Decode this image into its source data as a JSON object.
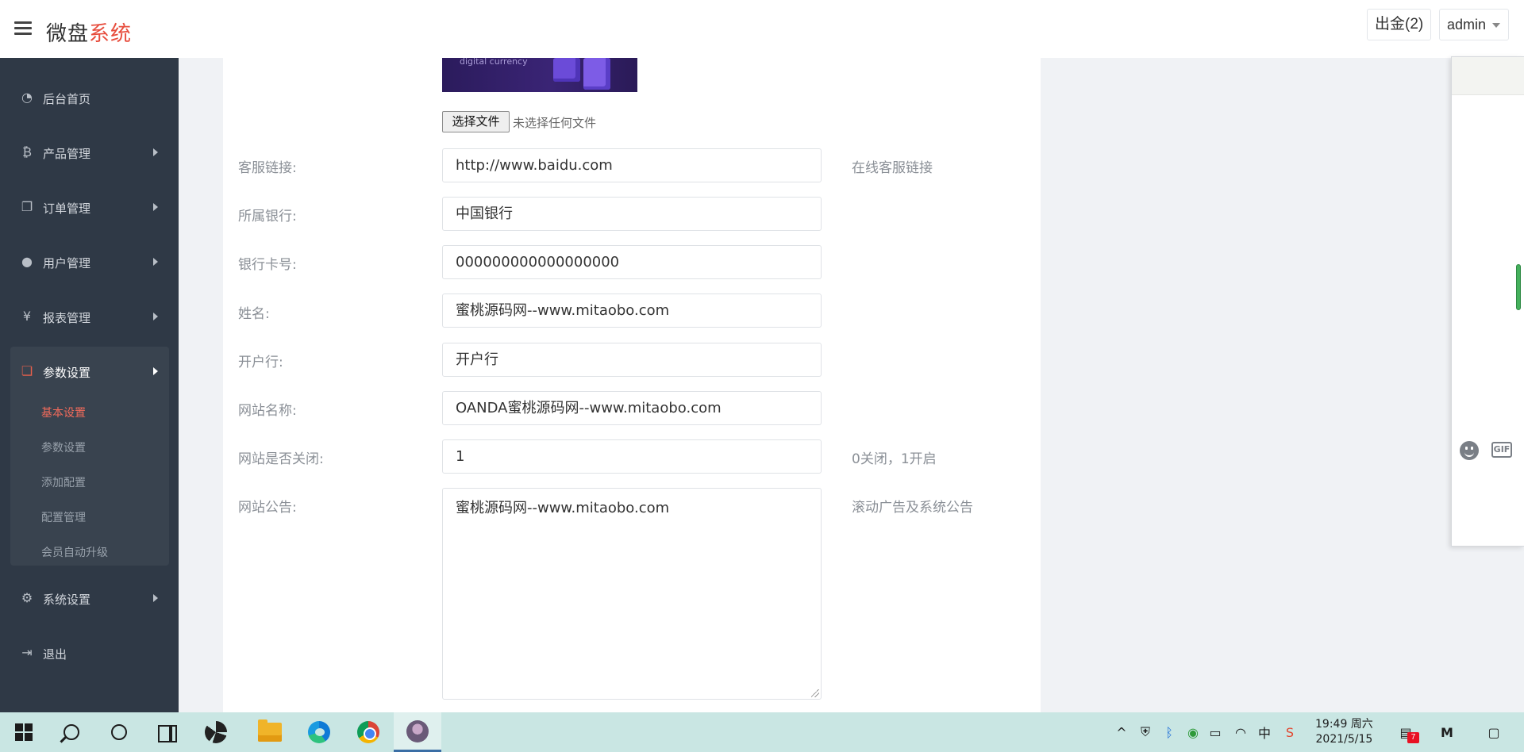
{
  "header": {
    "logo_main": "微盘",
    "logo_accent": "系统",
    "withdraw_button": "出金(2)",
    "user_menu": "admin"
  },
  "sidebar": {
    "items": [
      {
        "label": "后台首页",
        "icon": "dashboard-icon"
      },
      {
        "label": "产品管理",
        "icon": "bitcoin-icon"
      },
      {
        "label": "订单管理",
        "icon": "copy-icon"
      },
      {
        "label": "用户管理",
        "icon": "user-icon"
      },
      {
        "label": "报表管理",
        "icon": "yen-icon"
      },
      {
        "label": "参数设置",
        "icon": "files-icon",
        "expanded": true
      },
      {
        "label": "系统设置",
        "icon": "cogs-icon"
      },
      {
        "label": "退出",
        "icon": "sign-out-icon"
      }
    ],
    "sub_items": [
      "基本设置",
      "参数设置",
      "添加配置",
      "配置管理",
      "会员自动升级"
    ],
    "current_sub": "基本设置"
  },
  "banner": {
    "text": "digital currency"
  },
  "file_upload": {
    "button": "选择文件",
    "status": "未选择任何文件"
  },
  "form": {
    "fields": [
      {
        "label": "客服链接:",
        "value": "http://www.baidu.com",
        "help": "在线客服链接"
      },
      {
        "label": "所属银行:",
        "value": "中国银行",
        "help": ""
      },
      {
        "label": "银行卡号:",
        "value": "000000000000000000",
        "help": ""
      },
      {
        "label": "姓名:",
        "value": "蜜桃源码网--www.mitaobo.com",
        "help": ""
      },
      {
        "label": "开户行:",
        "value": "开户行",
        "help": ""
      },
      {
        "label": "网站名称:",
        "value": "OANDA蜜桃源码网--www.mitaobo.com",
        "help": ""
      },
      {
        "label": "网站是否关闭:",
        "value": "1",
        "help": "0关闭，1开启"
      }
    ],
    "notice": {
      "label": "网站公告:",
      "value": "蜜桃源码网--www.mitaobo.com",
      "help": "滚动广告及系统公告"
    }
  },
  "chat_panel": {
    "gif_label": "GIF",
    "icons": [
      "emoji-icon",
      "gif-icon"
    ]
  },
  "taskbar": {
    "time": "19:49 周六",
    "date": "2021/5/15",
    "ime": "中",
    "notification_count": "7",
    "apps": [
      "start-icon",
      "search-icon",
      "cortana-icon",
      "task-view-icon",
      "pinwheel-app-icon",
      "file-explorer-icon",
      "edge-icon",
      "chrome-icon",
      "avatar-app-icon"
    ]
  },
  "colors": {
    "accent": "#e74c3c",
    "sidebar_bg": "#2f3946",
    "active_sub": "#f26b5b",
    "taskbar_bg": "#c9e6e3"
  }
}
